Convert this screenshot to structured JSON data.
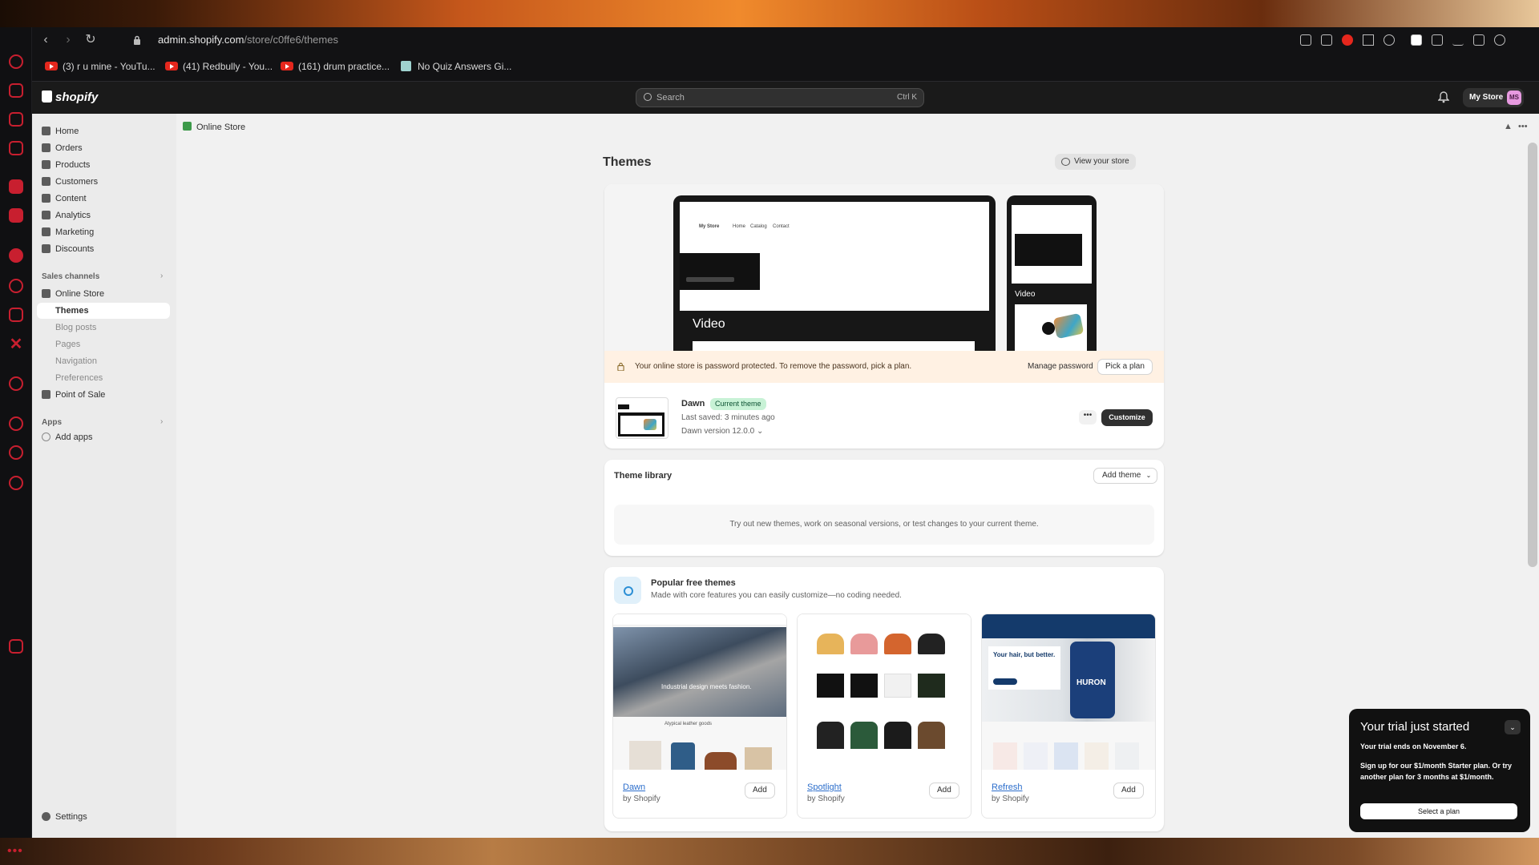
{
  "browser": {
    "url_host": "admin.shopify.com",
    "url_path": "/store/c0ffe6/themes",
    "bookmarks": [
      {
        "label": "(3) r u mine - YouTu...",
        "icon": "youtube-icon"
      },
      {
        "label": "(41) Redbully - You...",
        "icon": "youtube-icon"
      },
      {
        "label": "(161) drum practice...",
        "icon": "youtube-icon"
      },
      {
        "label": "No Quiz Answers Gi...",
        "icon": "doc-icon"
      }
    ]
  },
  "topbar": {
    "logo": "shopify",
    "search_placeholder": "Search",
    "search_shortcut": "Ctrl K",
    "store_label": "My Store",
    "avatar_initials": "MS"
  },
  "sidebar": {
    "items": [
      {
        "label": "Home",
        "icon": "home-icon"
      },
      {
        "label": "Orders",
        "icon": "orders-icon"
      },
      {
        "label": "Products",
        "icon": "tag-icon"
      },
      {
        "label": "Customers",
        "icon": "person-icon"
      },
      {
        "label": "Content",
        "icon": "content-icon"
      },
      {
        "label": "Analytics",
        "icon": "chart-icon"
      },
      {
        "label": "Marketing",
        "icon": "target-icon"
      },
      {
        "label": "Discounts",
        "icon": "discount-icon"
      }
    ],
    "sales_channels_title": "Sales channels",
    "online_store": "Online Store",
    "online_store_sub": [
      "Themes",
      "Blog posts",
      "Pages",
      "Navigation",
      "Preferences"
    ],
    "point_of_sale": "Point of Sale",
    "apps_title": "Apps",
    "add_apps": "Add apps",
    "settings": "Settings"
  },
  "main": {
    "breadcrumb": "Online Store",
    "title": "Themes",
    "view_store": "View your store",
    "preview": {
      "laptop_store": "My Store",
      "laptop_nav": [
        "Home",
        "Catalog",
        "Contact"
      ],
      "video_label": "Video",
      "phone_video_label": "Video"
    },
    "banner": {
      "message": "Your online store is password protected. To remove the password, pick a plan.",
      "manage": "Manage password",
      "pick": "Pick a plan"
    },
    "current_theme": {
      "name": "Dawn",
      "badge": "Current theme",
      "saved": "Last saved: 3 minutes ago",
      "version": "Dawn version 12.0.0",
      "more": "•••",
      "customize": "Customize"
    },
    "library": {
      "title": "Theme library",
      "add_theme": "Add theme",
      "empty": "Try out new themes, work on seasonal versions, or test changes to your current theme."
    },
    "popular": {
      "title": "Popular free themes",
      "subtitle": "Made with core features you can easily customize—no coding needed.",
      "themes": [
        {
          "name": "Dawn",
          "by": "by Shopify",
          "add": "Add"
        },
        {
          "name": "Spotlight",
          "by": "by Shopify",
          "add": "Add"
        },
        {
          "name": "Refresh",
          "by": "by Shopify",
          "add": "Add"
        }
      ],
      "dawn_headline": "Industrial design meets fashion.",
      "dawn_caption": "Atypical leather goods",
      "refresh_headline": "Your hair, but better.",
      "refresh_product": "HURON"
    }
  },
  "trial": {
    "title": "Your trial just started",
    "ends": "Your trial ends on November 6.",
    "desc": "Sign up for our $1/month Starter plan. Or try another plan for 3 months at $1/month.",
    "button": "Select a plan"
  }
}
